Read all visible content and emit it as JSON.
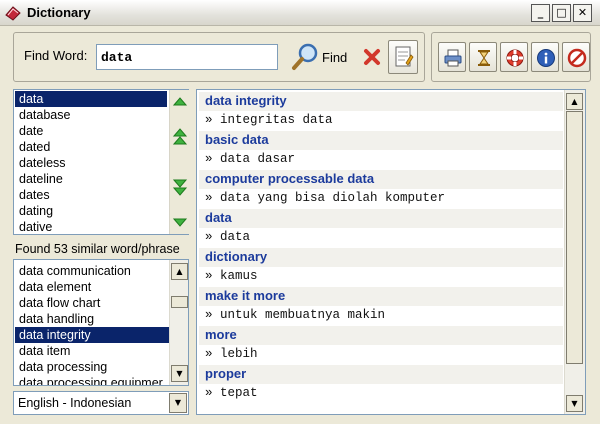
{
  "window": {
    "title": "Dictionary"
  },
  "search": {
    "label": "Find Word:",
    "value": "data",
    "find_label": "Find"
  },
  "word_list": {
    "items": [
      "data",
      "database",
      "date",
      "dated",
      "dateless",
      "dateline",
      "dates",
      "dating",
      "dative"
    ],
    "selected_index": 0
  },
  "found_text": "Found 53 similar word/phrase",
  "similar_list": {
    "items": [
      "data communication",
      "data element",
      "data flow chart",
      "data handling",
      "data integrity",
      "data item",
      "data processing",
      "data processing equipmer"
    ],
    "selected_index": 4
  },
  "language": {
    "selected": "English - Indonesian"
  },
  "definitions": [
    {
      "term": "data integrity",
      "translation": "» integritas data"
    },
    {
      "term": "basic data",
      "translation": "» data dasar"
    },
    {
      "term": "computer processable data",
      "translation": "» data yang bisa diolah komputer"
    },
    {
      "term": "data",
      "translation": "» data"
    },
    {
      "term": "dictionary",
      "translation": "» kamus"
    },
    {
      "term": "make it more",
      "translation": "» untuk membuatnya makin"
    },
    {
      "term": "more",
      "translation": "» lebih"
    },
    {
      "term": "proper",
      "translation": "» tepat"
    }
  ],
  "icons": {
    "app": "dictionary-book-icon",
    "find": "magnifier-icon",
    "clear": "red-x-icon",
    "note": "notepad-icon",
    "toolbar": [
      "printer-icon",
      "hourglass-icon",
      "lifebuoy-icon",
      "info-icon",
      "stop-icon"
    ]
  },
  "colors": {
    "selection": "#0a246a",
    "term_text": "#1c3b9c",
    "nav_arrow": "#2ea52e"
  }
}
